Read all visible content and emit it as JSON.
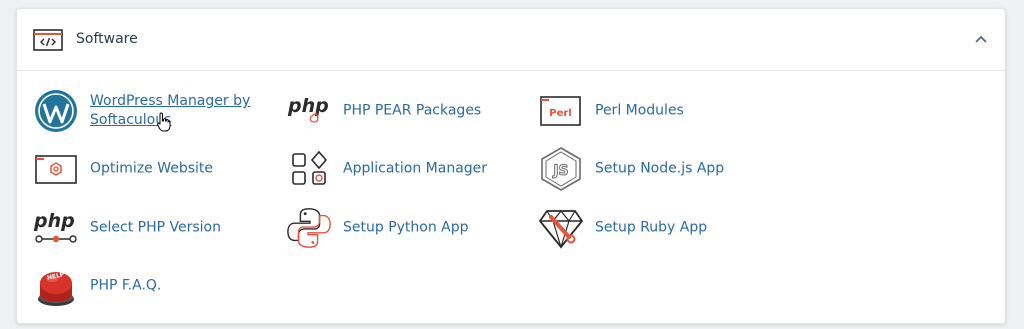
{
  "section": {
    "title": "Software",
    "icon": "code-window-icon",
    "collapse_icon": "chevron-up-icon"
  },
  "colors": {
    "link": "#2a6aa8",
    "title": "#293a4a",
    "accent_orange": "#e8533a",
    "icon_dark": "#2b2b2b"
  },
  "items": [
    {
      "label": "WordPress Manager by Softaculous",
      "icon": "wordpress-icon"
    },
    {
      "label": "PHP PEAR Packages",
      "icon": "php-pear-icon"
    },
    {
      "label": "Perl Modules",
      "icon": "perl-icon"
    },
    {
      "label": "Optimize Website",
      "icon": "optimize-website-icon"
    },
    {
      "label": "Application Manager",
      "icon": "application-manager-icon"
    },
    {
      "label": "Setup Node.js App",
      "icon": "nodejs-icon"
    },
    {
      "label": "Select PHP Version",
      "icon": "php-version-icon"
    },
    {
      "label": "Setup Python App",
      "icon": "python-icon"
    },
    {
      "label": "Setup Ruby App",
      "icon": "ruby-icon"
    },
    {
      "label": "PHP F.A.Q.",
      "icon": "help-button-icon"
    }
  ],
  "icon_text": {
    "php": "php",
    "perl": "Perl",
    "js": "JS",
    "help": "HELP"
  }
}
